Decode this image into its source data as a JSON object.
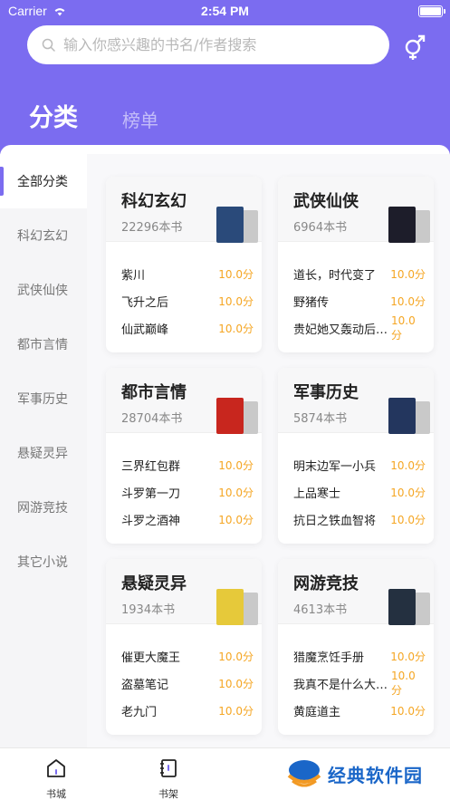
{
  "status_bar": {
    "carrier": "Carrier",
    "time": "2:54 PM"
  },
  "search": {
    "placeholder": "输入你感兴趣的书名/作者搜索"
  },
  "top_tabs": [
    {
      "label": "分类"
    },
    {
      "label": "榜单"
    }
  ],
  "sidebar": {
    "items": [
      {
        "label": "全部分类"
      },
      {
        "label": "科幻玄幻"
      },
      {
        "label": "武侠仙侠"
      },
      {
        "label": "都市言情"
      },
      {
        "label": "军事历史"
      },
      {
        "label": "悬疑灵异"
      },
      {
        "label": "网游竞技"
      },
      {
        "label": "其它小说"
      }
    ]
  },
  "categories": [
    {
      "title": "科幻玄幻",
      "count": "22296本书",
      "cover_color": "#2a4a7a",
      "books": [
        {
          "title": "紫川",
          "score": "10.0分"
        },
        {
          "title": "飞升之后",
          "score": "10.0分"
        },
        {
          "title": "仙武巅峰",
          "score": "10.0分"
        }
      ]
    },
    {
      "title": "武侠仙侠",
      "count": "6964本书",
      "cover_color": "#1d1d2a",
      "books": [
        {
          "title": "道长，时代变了",
          "score": "10.0分"
        },
        {
          "title": "野猪传",
          "score": "10.0分"
        },
        {
          "title": "贵妃她又轰动后宫了",
          "score": "10.0分"
        }
      ]
    },
    {
      "title": "都市言情",
      "count": "28704本书",
      "cover_color": "#c8261e",
      "books": [
        {
          "title": "三界红包群",
          "score": "10.0分"
        },
        {
          "title": "斗罗第一刀",
          "score": "10.0分"
        },
        {
          "title": "斗罗之酒神",
          "score": "10.0分"
        }
      ]
    },
    {
      "title": "军事历史",
      "count": "5874本书",
      "cover_color": "#23365e",
      "books": [
        {
          "title": "明末边军一小兵",
          "score": "10.0分"
        },
        {
          "title": "上品寒士",
          "score": "10.0分"
        },
        {
          "title": "抗日之铁血智将",
          "score": "10.0分"
        }
      ]
    },
    {
      "title": "悬疑灵异",
      "count": "1934本书",
      "cover_color": "#e6c93a",
      "books": [
        {
          "title": "催更大魔王",
          "score": "10.0分"
        },
        {
          "title": "盗墓笔记",
          "score": "10.0分"
        },
        {
          "title": "老九门",
          "score": "10.0分"
        }
      ]
    },
    {
      "title": "网游竞技",
      "count": "4613本书",
      "cover_color": "#243040",
      "books": [
        {
          "title": "猎魔烹饪手册",
          "score": "10.0分"
        },
        {
          "title": "我真不是什么大佬啊",
          "score": "10.0分"
        },
        {
          "title": "黄庭道主",
          "score": "10.0分"
        }
      ]
    }
  ],
  "tabbar": {
    "items": [
      {
        "label": "书城"
      },
      {
        "label": "书架"
      }
    ]
  },
  "watermark": {
    "text": "经典软件园"
  },
  "colors": {
    "accent": "#7b6cf0",
    "score": "#f5a623"
  },
  "icons": {
    "search": "search-icon",
    "gender": "gender-switch-icon",
    "store": "home-icon",
    "shelf": "bookshelf-icon"
  }
}
